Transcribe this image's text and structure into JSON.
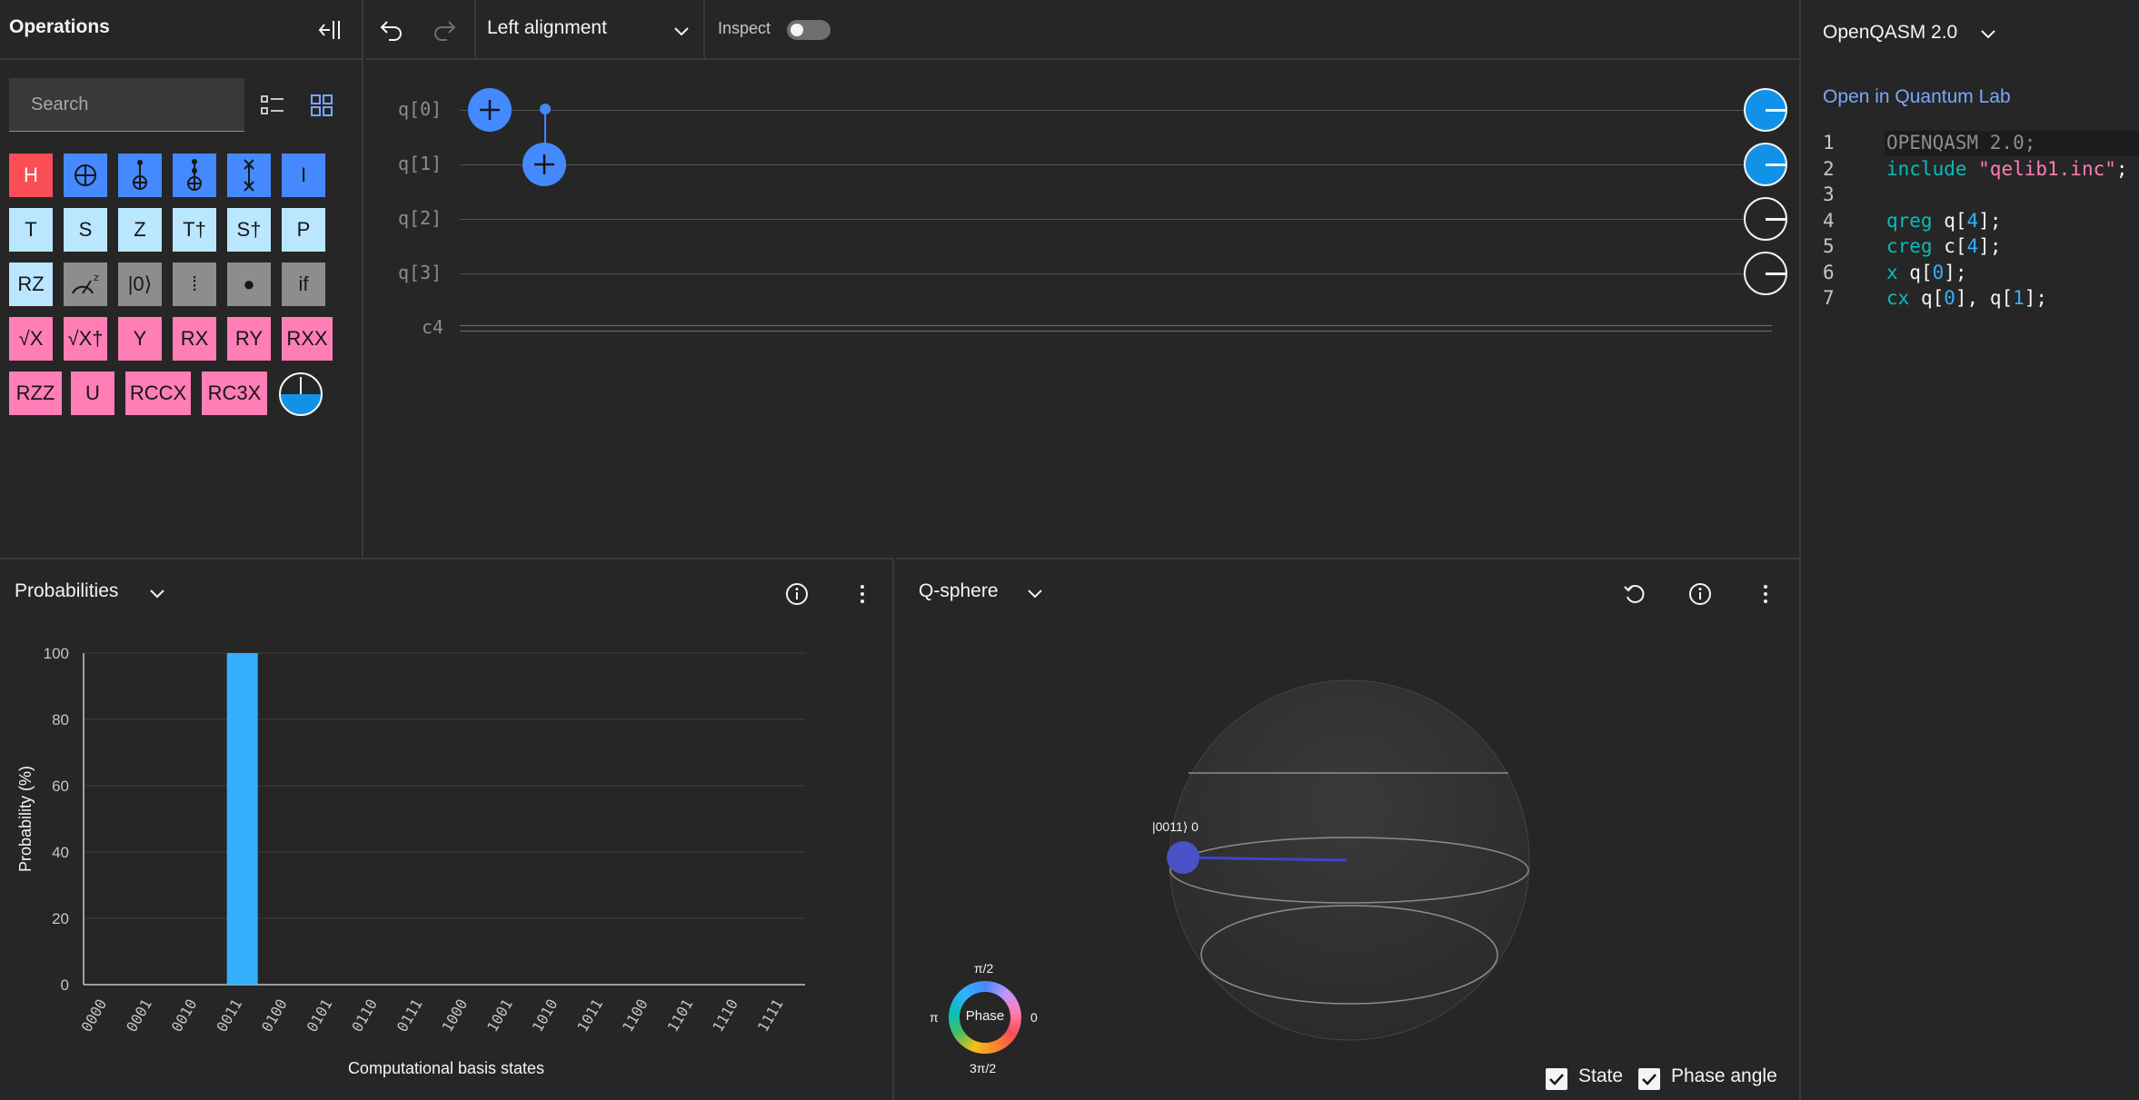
{
  "operations": {
    "title": "Operations",
    "search_placeholder": "Search",
    "gates": [
      {
        "label": "H",
        "color": "red"
      },
      {
        "label": "",
        "color": "blue",
        "icon": "cnot-icon"
      },
      {
        "label": "",
        "color": "blue",
        "icon": "ccx-icon"
      },
      {
        "label": "",
        "color": "blue",
        "icon": "toffoli-icon"
      },
      {
        "label": "",
        "color": "blue",
        "icon": "swap-icon"
      },
      {
        "label": "I",
        "color": "blue"
      },
      {
        "label": "T",
        "color": "light"
      },
      {
        "label": "S",
        "color": "light"
      },
      {
        "label": "Z",
        "color": "light"
      },
      {
        "label": "T†",
        "color": "light"
      },
      {
        "label": "S†",
        "color": "light"
      },
      {
        "label": "P",
        "color": "light"
      },
      {
        "label": "RZ",
        "color": "light"
      },
      {
        "label": "",
        "color": "gray",
        "icon": "measure-z-icon"
      },
      {
        "label": "|0⟩",
        "color": "gray"
      },
      {
        "label": "⁞",
        "color": "gray"
      },
      {
        "label": "●",
        "color": "gray"
      },
      {
        "label": "if",
        "color": "gray"
      },
      {
        "label": "√X",
        "color": "pink"
      },
      {
        "label": "√X†",
        "color": "pink"
      },
      {
        "label": "Y",
        "color": "pink"
      },
      {
        "label": "RX",
        "color": "pink"
      },
      {
        "label": "RY",
        "color": "pink"
      },
      {
        "label": "RXX",
        "color": "pink"
      },
      {
        "label": "RZZ",
        "color": "pink"
      },
      {
        "label": "U",
        "color": "pink"
      },
      {
        "label": "RCCX",
        "color": "pink"
      },
      {
        "label": "RC3X",
        "color": "pink"
      }
    ]
  },
  "toolbar": {
    "alignment": "Left alignment",
    "inspect_label": "Inspect",
    "inspect_on": false
  },
  "circuit": {
    "qubits": [
      "q[0]",
      "q[1]",
      "q[2]",
      "q[3]"
    ],
    "classical": "c4"
  },
  "probabilities": {
    "title": "Probabilities",
    "chart_data": {
      "type": "bar",
      "categories": [
        "0000",
        "0001",
        "0010",
        "0011",
        "0100",
        "0101",
        "0110",
        "0111",
        "1000",
        "1001",
        "1010",
        "1011",
        "1100",
        "1101",
        "1110",
        "1111"
      ],
      "values": [
        0,
        0,
        0,
        100,
        0,
        0,
        0,
        0,
        0,
        0,
        0,
        0,
        0,
        0,
        0,
        0
      ],
      "xlabel": "Computational basis states",
      "ylabel": "Probability (%)",
      "ylim": [
        0,
        100
      ],
      "yticks": [
        "0",
        "20",
        "40",
        "60",
        "80",
        "100"
      ],
      "bar_color": "#33b1ff",
      "grid": true
    }
  },
  "qsphere": {
    "title": "Q-sphere",
    "state_label": "|0011⟩ 0",
    "phase": {
      "center": "Phase",
      "top": "π/2",
      "left": "π",
      "right": "0",
      "bottom": "3π/2"
    },
    "state_checkbox": "State",
    "phase_checkbox": "Phase angle"
  },
  "code": {
    "language": "OpenQASM 2.0",
    "link": "Open in Quantum Lab",
    "lines": [
      {
        "n": "1",
        "parts": [
          [
            "gray",
            "OPENQASM 2.0;"
          ]
        ]
      },
      {
        "n": "2",
        "parts": [
          [
            "kw",
            "include "
          ],
          [
            "str",
            "\"qelib1.inc\""
          ],
          [
            "plain",
            ";"
          ]
        ]
      },
      {
        "n": "3",
        "parts": []
      },
      {
        "n": "4",
        "parts": [
          [
            "kw",
            "qreg "
          ],
          [
            "plain",
            "q["
          ],
          [
            "num",
            "4"
          ],
          [
            "plain",
            "];"
          ]
        ]
      },
      {
        "n": "5",
        "parts": [
          [
            "kw",
            "creg "
          ],
          [
            "plain",
            "c["
          ],
          [
            "num",
            "4"
          ],
          [
            "plain",
            "];"
          ]
        ]
      },
      {
        "n": "6",
        "parts": [
          [
            "kw",
            "x "
          ],
          [
            "plain",
            "q["
          ],
          [
            "num",
            "0"
          ],
          [
            "plain",
            "];"
          ]
        ]
      },
      {
        "n": "7",
        "parts": [
          [
            "kw",
            "cx "
          ],
          [
            "plain",
            "q["
          ],
          [
            "num",
            "0"
          ],
          [
            "plain",
            "], q["
          ],
          [
            "num",
            "1"
          ],
          [
            "plain",
            "];"
          ]
        ]
      }
    ]
  }
}
